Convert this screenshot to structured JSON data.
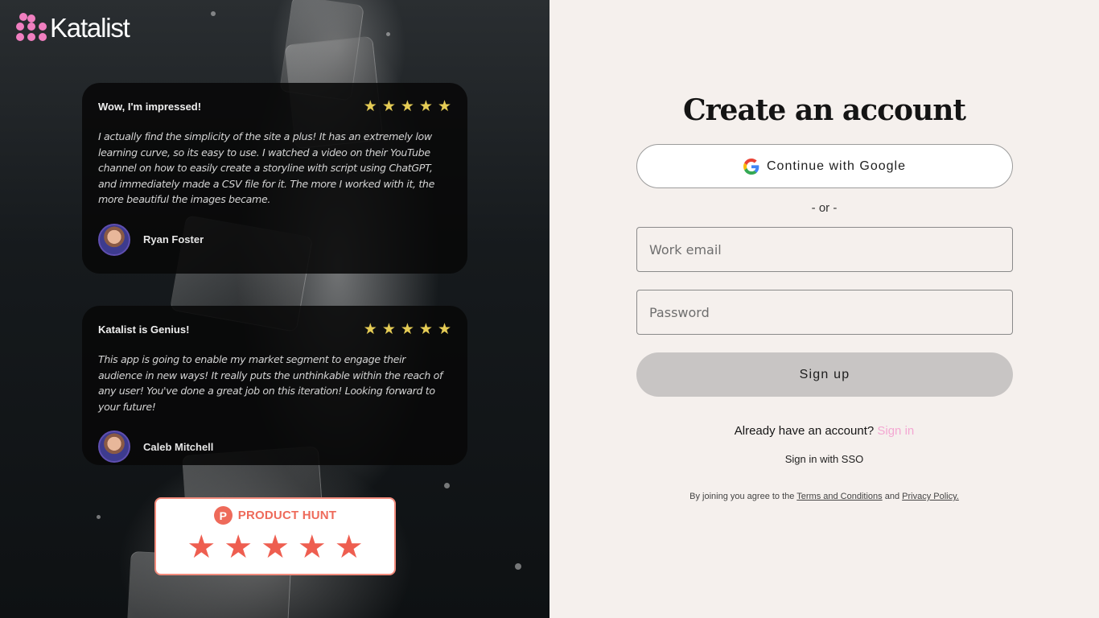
{
  "brand": {
    "name": "Katalist",
    "accent": "#f07fc0"
  },
  "reviews": [
    {
      "title": "Wow, I'm impressed!",
      "rating": 5,
      "body": "I actually find the simplicity of the site a plus! It has an extremely low learning curve, so its easy to use. I watched a video on their YouTube channel on how to easily create a storyline with script using ChatGPT, and immediately made a CSV file for it. The more I worked with it, the more beautiful the images became.",
      "author": "Ryan Foster"
    },
    {
      "title": "Katalist is Genius!",
      "rating": 5,
      "body": "This app is going to enable my market segment to engage their audience in new ways! It really puts the unthinkable within the reach of any user! You've done a great job on this iteration! Looking forward to your future!",
      "author": "Caleb Mitchell"
    }
  ],
  "product_hunt": {
    "logo_letter": "P",
    "label": "PRODUCT HUNT",
    "rating": 5
  },
  "signup": {
    "title": "Create an account",
    "google_label": "Continue with Google",
    "or_text": "- or -",
    "email_placeholder": "Work email",
    "password_placeholder": "Password",
    "submit_label": "Sign up",
    "have_account_text": "Already have an account?",
    "signin_link": "Sign in",
    "sso_link": "Sign in with SSO",
    "terms_prefix": "By joining you agree to the",
    "terms_link": "Terms and Conditions",
    "terms_and": "and",
    "privacy_link": "Privacy Policy."
  }
}
